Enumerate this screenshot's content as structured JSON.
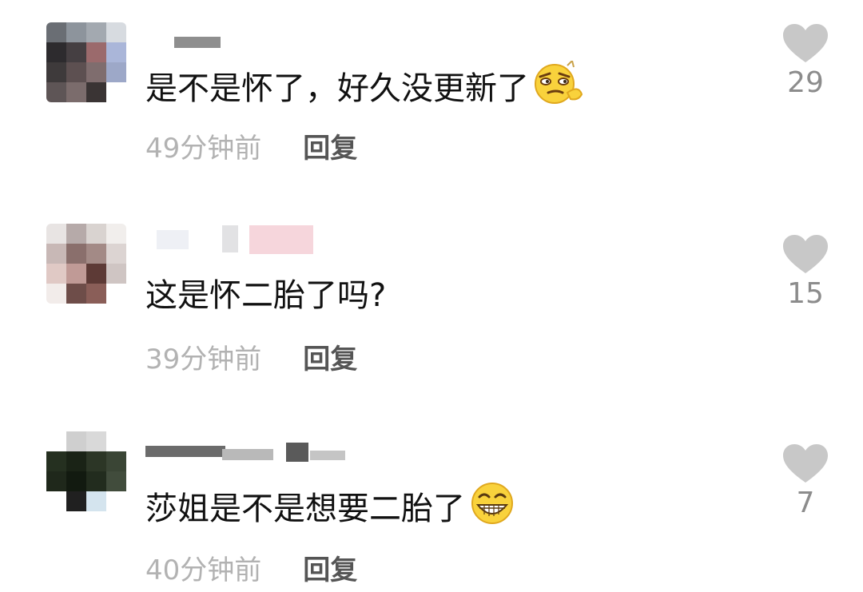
{
  "comments": [
    {
      "text": "是不是怀了，好久没更新了",
      "emoji_icon": "smirk-emoji-icon",
      "time": "49分钟前",
      "reply_label": "回复",
      "likes": "29"
    },
    {
      "text": "这是怀二胎了吗?",
      "time": "39分钟前",
      "reply_label": "回复",
      "likes": "15"
    },
    {
      "text": "莎姐是不是想要二胎了",
      "emoji_icon": "grin-emoji-icon",
      "time": "40分钟前",
      "reply_label": "回复",
      "likes": "7"
    }
  ],
  "colors": {
    "text": "#111111",
    "time": "#b2b2b2",
    "reply": "#555555",
    "like_icon": "#c8c8c8",
    "like_count": "#8c8c8c"
  }
}
